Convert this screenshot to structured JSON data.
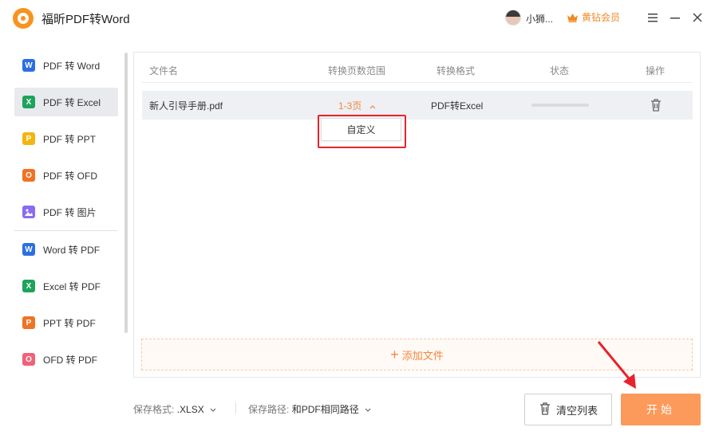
{
  "app": {
    "title": "福昕PDF转Word"
  },
  "user": {
    "name": "小狮...",
    "vip_label": "黄钻会员"
  },
  "sidebar": {
    "items": [
      {
        "label": "PDF 转 Word",
        "icon": "word-icon",
        "letter": "W",
        "color": "#2b6fe3",
        "active": false
      },
      {
        "label": "PDF 转 Excel",
        "icon": "excel-icon",
        "letter": "X",
        "color": "#1ea35b",
        "active": true
      },
      {
        "label": "PDF 转 PPT",
        "icon": "ppt-icon",
        "letter": "P",
        "color": "#f5b50f",
        "active": false
      },
      {
        "label": "PDF 转 OFD",
        "icon": "ofd-icon",
        "letter": "O",
        "color": "#f07324",
        "active": false
      },
      {
        "label": "PDF 转 图片",
        "icon": "image-icon",
        "letter": "",
        "color": "#8b6cf0",
        "active": false
      },
      {
        "label": "Word 转 PDF",
        "icon": "word-to-pdf-icon",
        "letter": "W",
        "color": "#2b6fe3",
        "active": false
      },
      {
        "label": "Excel 转 PDF",
        "icon": "excel-to-pdf-icon",
        "letter": "X",
        "color": "#1ea35b",
        "active": false
      },
      {
        "label": "PPT 转 PDF",
        "icon": "ppt-to-pdf-icon",
        "letter": "P",
        "color": "#f07324",
        "active": false
      },
      {
        "label": "OFD 转 PDF",
        "icon": "ofd-to-pdf-icon",
        "letter": "O",
        "color": "#f0627a",
        "active": false
      }
    ]
  },
  "table": {
    "headers": [
      "文件名",
      "转换页数范围",
      "转换格式",
      "状态",
      "操作"
    ],
    "rows": [
      {
        "filename": "新人引导手册.pdf",
        "range": "1-3页",
        "format": "PDF转Excel",
        "progress": 0
      }
    ],
    "dropdown_option": "自定义"
  },
  "add_file_label": "添加文件",
  "footer": {
    "format_label": "保存格式:",
    "format_value": ".XLSX",
    "path_label": "保存路径:",
    "path_value": "和PDF相同路径",
    "clear_label": "清空列表",
    "start_label": "开始"
  },
  "colors": {
    "accent": "#f5853f",
    "highlight": "#e8232b",
    "start_button": "#fb9a5b"
  }
}
